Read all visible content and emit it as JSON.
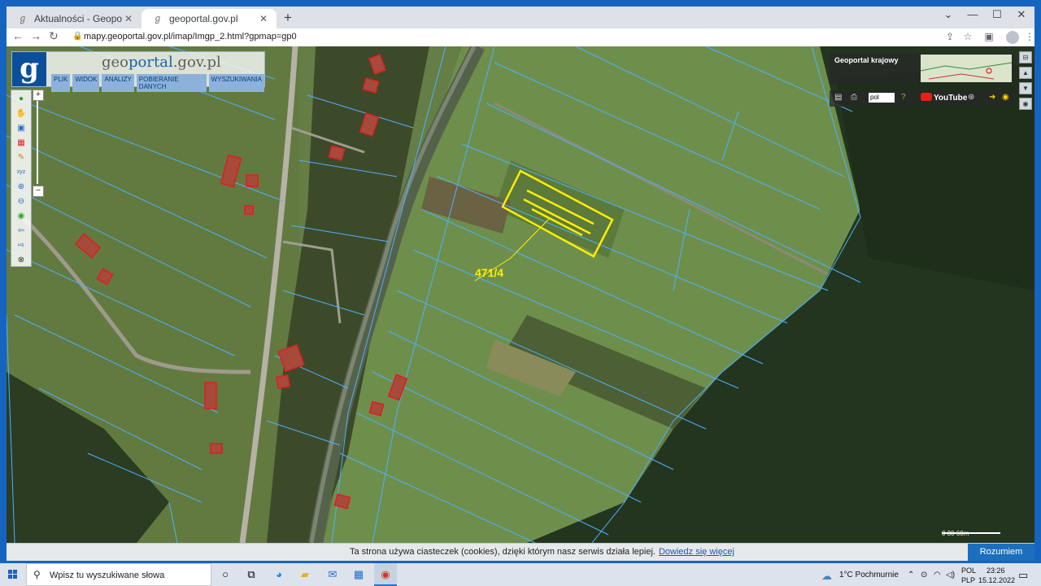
{
  "browser": {
    "tabs": [
      {
        "title": "Aktualności - Geoportal Krajowy",
        "active": false
      },
      {
        "title": "geoportal.gov.pl",
        "active": true
      }
    ],
    "url": "mapy.geoportal.gov.pl/imap/Imgp_2.html?gpmap=gp0"
  },
  "header": {
    "logo_prefix": "geo",
    "logo_highlight": "portal",
    "logo_suffix": ".gov.pl",
    "menu": [
      "PLIK",
      "WIDOK",
      "ANALIZY",
      "POBIERANIE DANYCH",
      "WYSZUKIWANIA"
    ]
  },
  "overview": {
    "title": "Geoportal krajowy"
  },
  "toolbar2": {
    "language": "pol",
    "youtube_label": "YouTube"
  },
  "map": {
    "parcel_label": "471/4",
    "scale_text": "0     30     60m"
  },
  "cookie": {
    "text": "Ta strona używa ciasteczek (cookies), dzięki którym nasz serwis działa lepiej.",
    "link": "Dowiedz się więcej",
    "button": "Rozumiem"
  },
  "taskbar": {
    "search_placeholder": "Wpisz tu wyszukiwane słowa",
    "weather": "1°C  Pochmurnie",
    "lang_top": "POL",
    "lang_bottom": "PLP",
    "time": "23:26",
    "date": "15.12.2022"
  },
  "colors": {
    "accent": "#1565c0",
    "parcel_highlight": "#ffee00",
    "parcel_lines": "#4db0ff",
    "buildings": "#e01e1e"
  }
}
